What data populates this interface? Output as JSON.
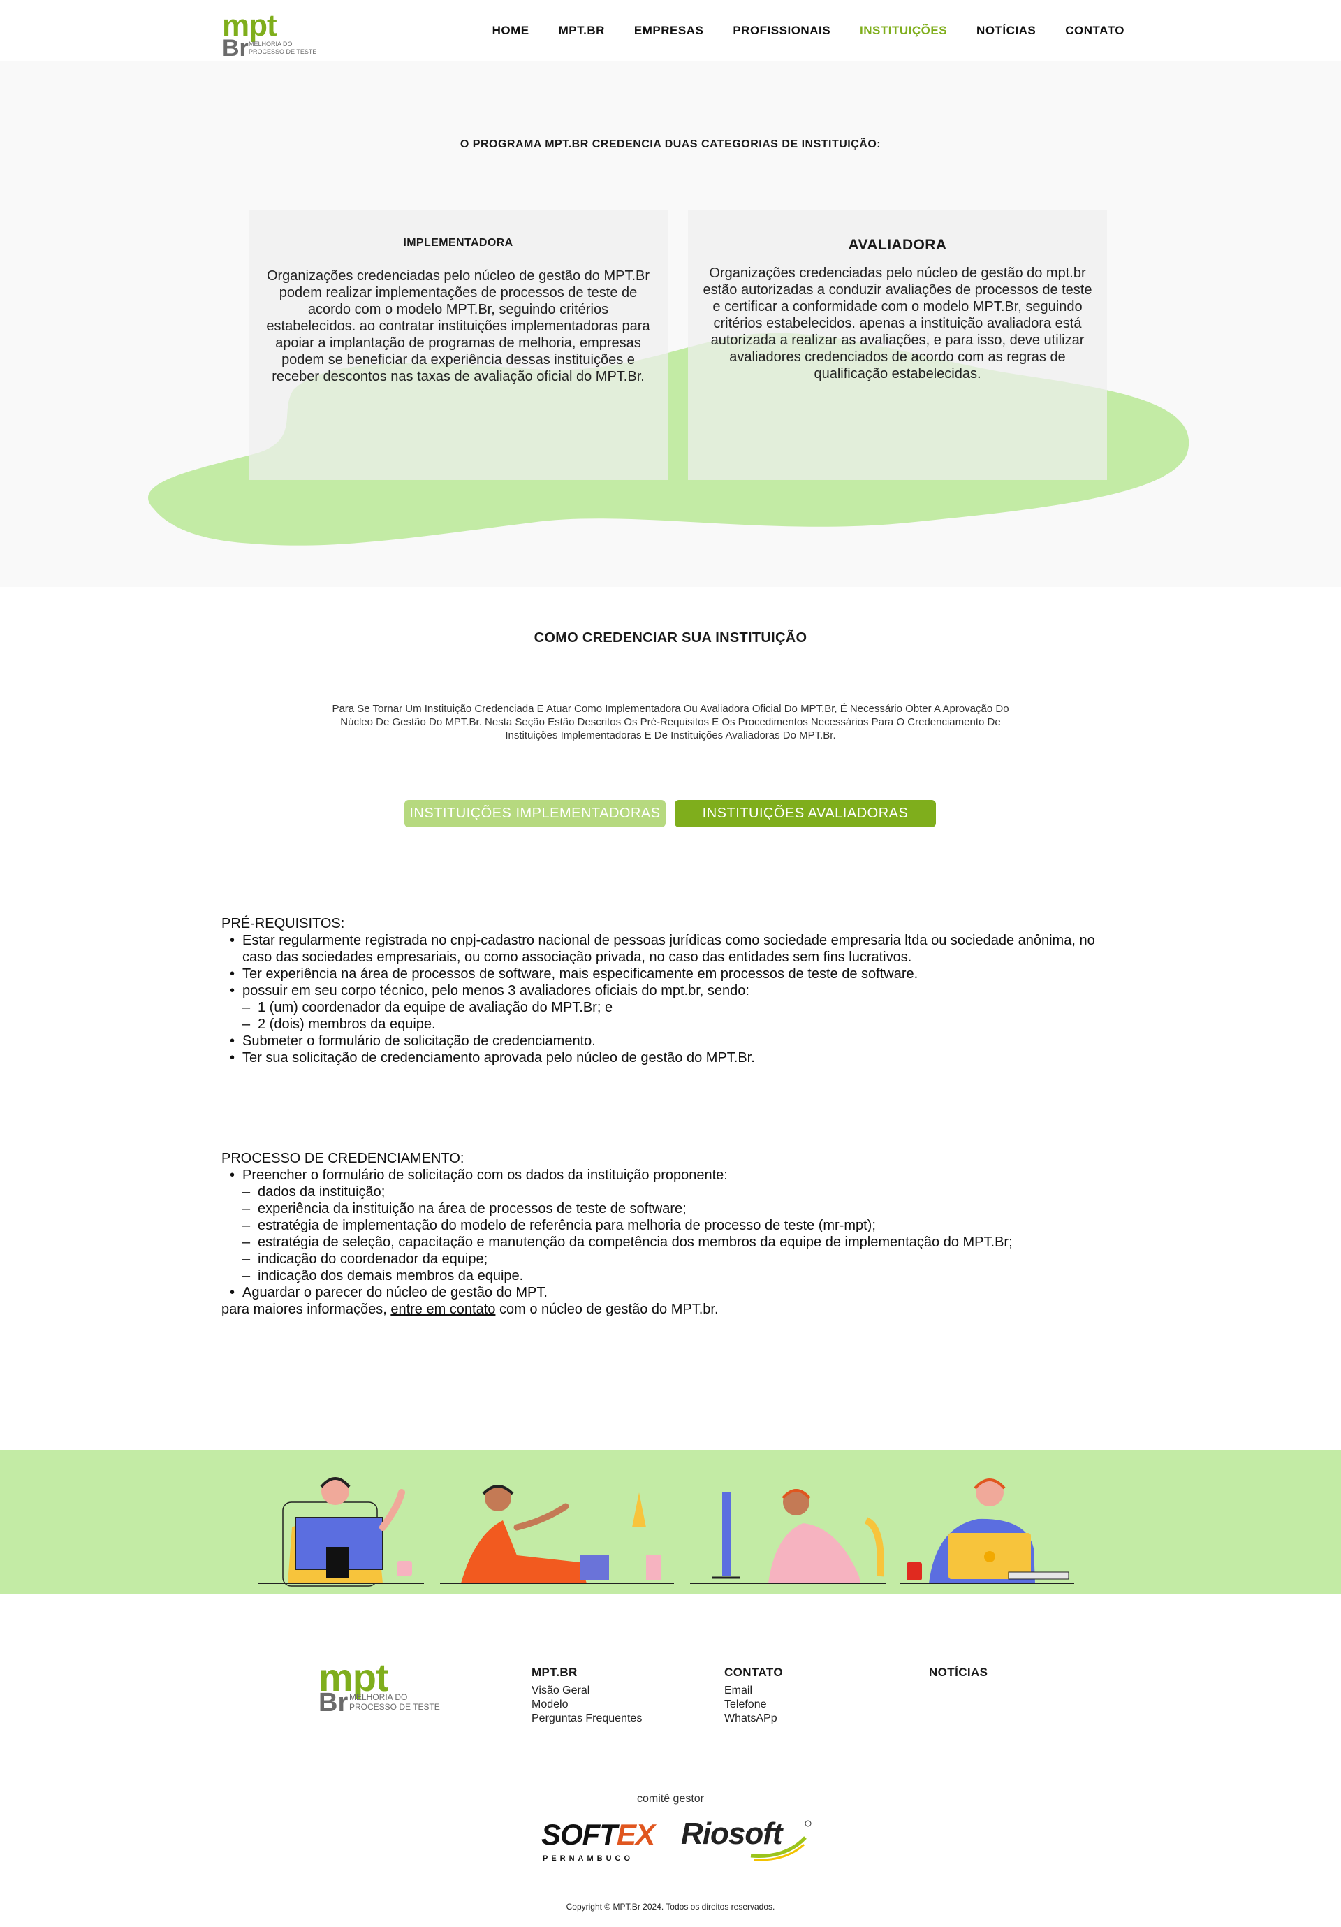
{
  "header": {
    "logo": {
      "mpt": "mpt",
      "br": "Br",
      "subtitle": "MELHORIA DO PROCESSO DE TESTE"
    },
    "nav": [
      "HOME",
      "MPT.BR",
      "EMPRESAS",
      "PROFISSIONAIS",
      "INSTITUIÇÕES",
      "NOTÍCIAS",
      "CONTATO"
    ],
    "active_nav": "INSTITUIÇÕES"
  },
  "intro": {
    "title": "O PROGRAMA MPT.BR CREDENCIA DUAS CATEGORIAS DE INSTITUIÇÃO:",
    "cards": [
      {
        "title": "IMPLEMENTADORA",
        "text": "Organizações credenciadas pelo núcleo de gestão do MPT.Br podem realizar implementações de processos de teste de acordo com o modelo MPT.Br, seguindo critérios estabelecidos. ao contratar instituições implementadoras para apoiar a implantação de programas de melhoria, empresas podem se beneficiar da experiência dessas instituições e receber descontos nas taxas de avaliação oficial do MPT.Br."
      },
      {
        "title": "AVALIADORA",
        "text": "Organizações credenciadas pelo núcleo de gestão do mpt.br estão autorizadas a conduzir avaliações de processos de teste e certificar a conformidade com o modelo MPT.Br, seguindo critérios estabelecidos. apenas a instituição avaliadora está autorizada a realizar as avaliações, e para isso, deve utilizar avaliadores credenciados de acordo com as regras de qualificação estabelecidas."
      }
    ]
  },
  "how": {
    "title": "COMO CREDENCIAR SUA INSTITUIÇÃO",
    "description": "Para Se Tornar Um Instituição Credenciada E Atuar Como Implementadora Ou Avaliadora Oficial Do MPT.Br, É Necessário Obter A Aprovação Do Núcleo De Gestão Do MPT.Br. Nesta Seção Estão Descritos Os Pré-Requisitos E Os Procedimentos Necessários Para O Credenciamento De Instituições Implementadoras E De Instituições Avaliadoras Do MPT.Br.",
    "tabs": [
      "INSTITUIÇÕES IMPLEMENTADORAS",
      "INSTITUIÇÕES AVALIADORAS"
    ],
    "active_tab": "INSTITUIÇÕES AVALIADORAS"
  },
  "requirements": {
    "title": "PRÉ-REQUISITOS:",
    "items": [
      "Estar regularmente registrada no cnpj-cadastro nacional de pessoas jurídicas como sociedade empresaria ltda ou sociedade anônima, no caso das sociedades empresariais, ou como associação privada, no caso das entidades sem fins lucrativos.",
      "Ter experiência na área de processos de software, mais especificamente em processos de teste de software.",
      "possuir em seu corpo técnico, pelo menos 3 avaliadores oficiais do mpt.br, sendo:",
      "Submeter o formulário de solicitação de credenciamento.",
      "Ter sua solicitação de credenciamento aprovada pelo núcleo de gestão do MPT.Br."
    ],
    "subitems": [
      "1 (um) coordenador da equipe de avaliação do MPT.Br; e",
      "2 (dois) membros da equipe."
    ]
  },
  "process": {
    "title": "PROCESSO DE CREDENCIAMENTO:",
    "items": [
      "Preencher o formulário de solicitação com os dados da instituição proponente:",
      "Aguardar o parecer do núcleo de gestão do MPT."
    ],
    "subitems": [
      "dados da instituição;",
      "experiência da instituição na área de processos de teste de software;",
      "estratégia de implementação do modelo de referência para melhoria de processo de teste (mr-mpt);",
      "estratégia de seleção, capacitação e manutenção da competência dos membros da equipe de implementação do MPT.Br;",
      "indicação do coordenador da equipe;",
      "indicação dos demais membros da equipe."
    ],
    "note_before": "para maiores informações, ",
    "note_link": "entre em contato",
    "note_after": " com o núcleo de gestão do MPT.br."
  },
  "band": {
    "color": "#c3eba5",
    "illustrations": [
      "support-agent-desktop",
      "support-agent-laptop",
      "support-agent-monitor",
      "support-agent-laptop-2"
    ]
  },
  "footer": {
    "logo": {
      "mpt": "mpt",
      "br": "Br",
      "subtitle": "MELHORIA DO PROCESSO DE TESTE"
    },
    "columns": [
      {
        "title": "MPT.BR",
        "links": [
          "Visão Geral",
          "Modelo",
          "Perguntas Frequentes"
        ]
      },
      {
        "title": "CONTATO",
        "links": [
          "Email",
          "Telefone",
          "WhatsAPp"
        ]
      },
      {
        "title": "NOTÍCIAS",
        "links": []
      }
    ],
    "committee_label": "comitê gestor",
    "partners": {
      "softex": {
        "soft": "SOFT",
        "ex": "EX",
        "sub": "PERNAMBUCO"
      },
      "riosoft": "Riosoft"
    },
    "copyright": "Copyright © MPT.Br 2024. Todos os direitos reservados."
  },
  "colors": {
    "accent": "#7fae1c",
    "accent_light": "#b6d97f",
    "blob": "#c3eba5",
    "intro_bg": "#f9f9f9"
  }
}
